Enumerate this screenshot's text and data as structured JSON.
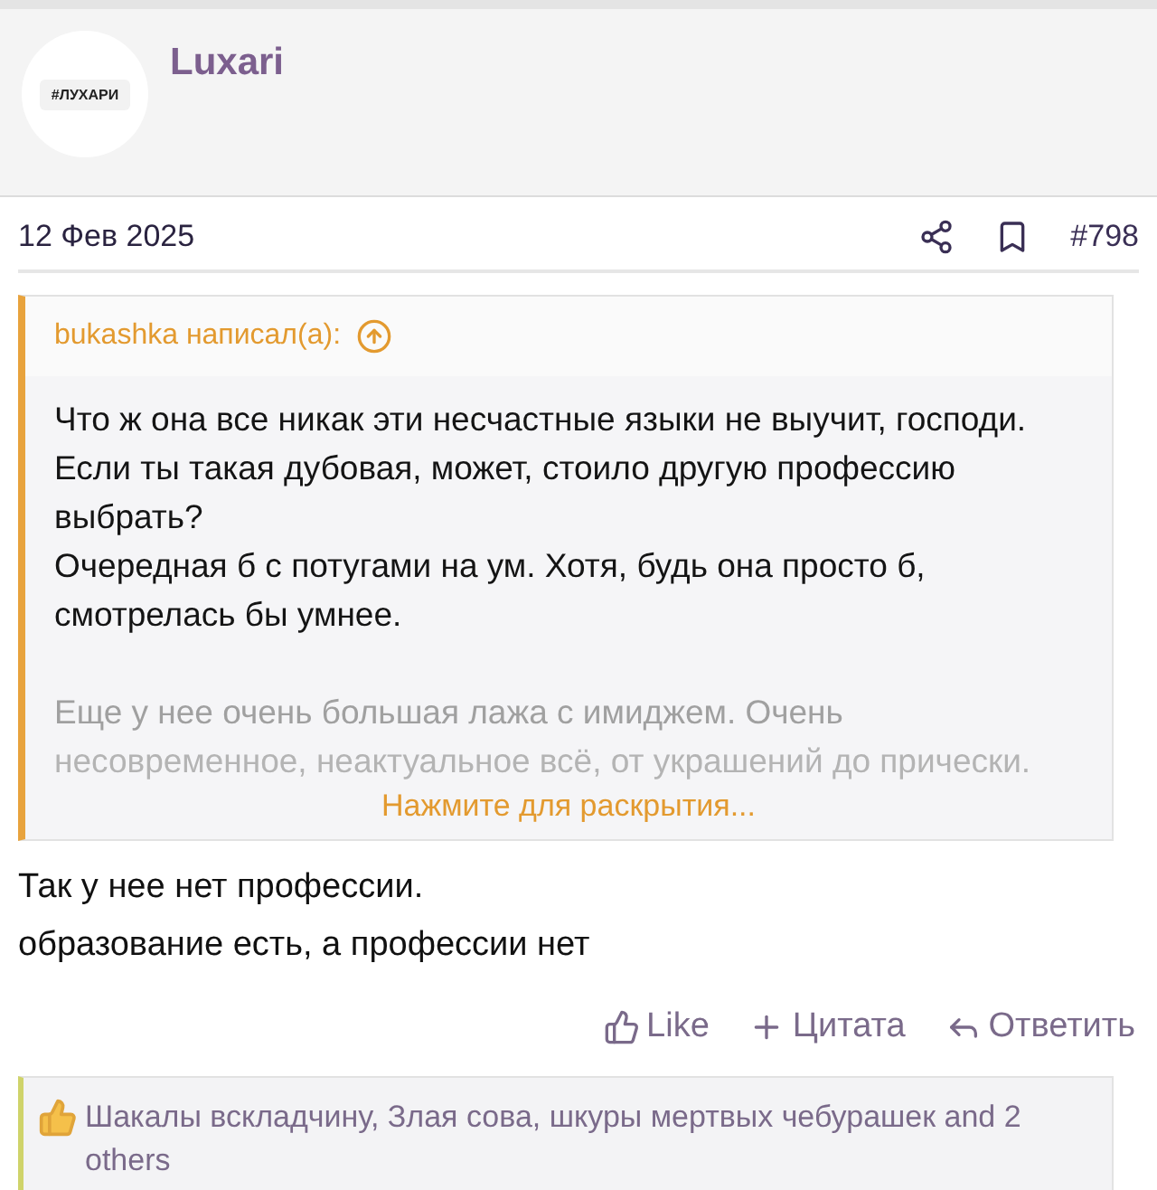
{
  "author": {
    "avatar_label": "#ЛУХАРИ",
    "name": "Luxari"
  },
  "post_meta": {
    "date": "12 Фев 2025",
    "number": "#798"
  },
  "quote": {
    "attribution": "bukashka написал(a):",
    "lines": [
      "Что ж она все никак эти несчастные языки не выучит, господи.",
      "Если ты такая дубовая, может, стоило другую профессию выбрать?",
      "Очередная б с потугами на ум. Хотя, будь она просто б, смотрелась бы умнее."
    ],
    "faded_lines": [
      "Еще у нее очень большая лажа с имиджем. Очень",
      "несовременное, неактуальное всё, от украшений до прически."
    ],
    "expand_link": "Нажмите для раскрытия..."
  },
  "body": [
    "Так у нее нет профессии.",
    "образование есть, а профессии нет"
  ],
  "actions": [
    {
      "kind": "like",
      "label": "Like"
    },
    {
      "kind": "quote",
      "label": "Цитата"
    },
    {
      "kind": "reply",
      "label": "Ответить"
    }
  ],
  "likes": {
    "text": "Шакалы вскладчину, Злая сова, шкуры мертвых чебурашек and 2 others"
  }
}
